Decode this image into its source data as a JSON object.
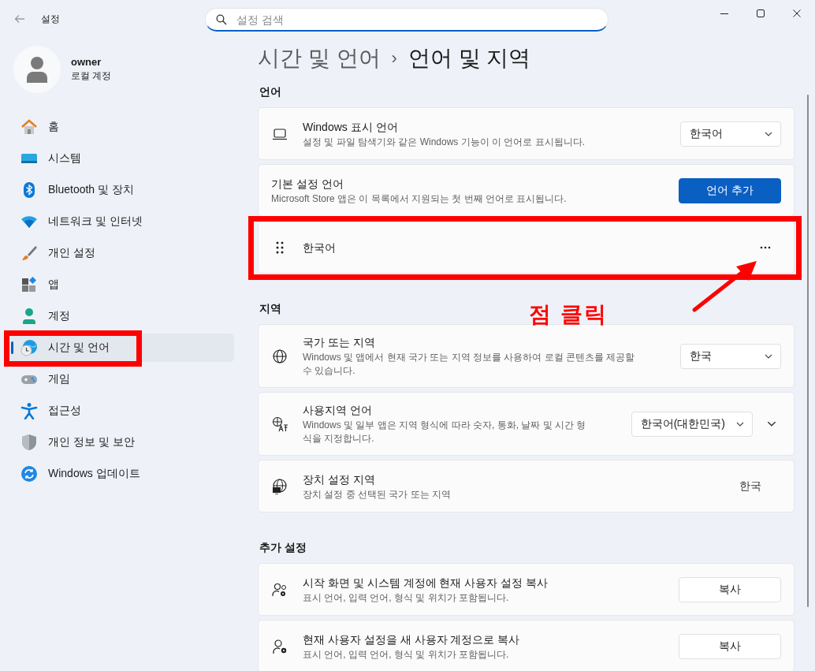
{
  "window": {
    "title": "설정"
  },
  "search": {
    "placeholder": "설정 검색"
  },
  "profile": {
    "name": "owner",
    "account": "로컬 계정"
  },
  "sidebar": {
    "items": [
      {
        "label": "홈",
        "selected": false,
        "highlighted": false
      },
      {
        "label": "시스템",
        "selected": false,
        "highlighted": false
      },
      {
        "label": "Bluetooth 및 장치",
        "selected": false,
        "highlighted": false
      },
      {
        "label": "네트워크 및 인터넷",
        "selected": false,
        "highlighted": false
      },
      {
        "label": "개인 설정",
        "selected": false,
        "highlighted": false
      },
      {
        "label": "앱",
        "selected": false,
        "highlighted": false
      },
      {
        "label": "계정",
        "selected": false,
        "highlighted": false
      },
      {
        "label": "시간 및 언어",
        "selected": true,
        "highlighted": true
      },
      {
        "label": "게임",
        "selected": false,
        "highlighted": false
      },
      {
        "label": "접근성",
        "selected": false,
        "highlighted": false
      },
      {
        "label": "개인 정보 및 보안",
        "selected": false,
        "highlighted": false
      },
      {
        "label": "Windows 업데이트",
        "selected": false,
        "highlighted": false
      }
    ]
  },
  "breadcrumb": {
    "parent": "시간 및 언어",
    "separator": "›",
    "current": "언어 및 지역"
  },
  "sections": [
    {
      "title": "언어",
      "rows": [
        {
          "kind": "dropdown",
          "title": "Windows 표시 언어",
          "description": "설정 및 파일 탐색기와 같은 Windows 기능이 이 언어로 표시됩니다.",
          "value": "한국어",
          "highlighted": false
        },
        {
          "kind": "button",
          "title": "기본 설정 언어",
          "description": "Microsoft Store 앱은 이 목록에서 지원되는 첫 번째 언어로 표시됩니다.",
          "button": "언어 추가",
          "primary": true,
          "highlighted": false
        },
        {
          "kind": "language",
          "title": "한국어",
          "highlighted": true
        }
      ]
    },
    {
      "title": "지역",
      "rows": [
        {
          "kind": "dropdown",
          "title": "국가 또는 지역",
          "description": "Windows 및 앱에서 현재 국가 또는 지역 정보를 사용하여 로컬 콘텐츠를 제공할 수 있습니다.",
          "value": "한국",
          "highlighted": false
        },
        {
          "kind": "dropdown",
          "title": "사용지역 언어",
          "description": "Windows 및 일부 앱은 지역 형식에 따라 숫자, 통화, 날짜 및 시간 형식을 지정합니다.",
          "value": "한국어(대한민국)",
          "expanded": false,
          "highlighted": false
        },
        {
          "kind": "text",
          "title": "장치 설정 지역",
          "description": "장치 설정 중 선택된 국가 또는 지역",
          "value": "한국",
          "highlighted": false
        }
      ]
    },
    {
      "title": "추가 설정",
      "rows": [
        {
          "kind": "button",
          "title": "시작 화면 및 시스템 계정에 현재 사용자 설정 복사",
          "description": "표시 언어, 입력 언어, 형식 및 위치가 포함됩니다.",
          "button": "복사",
          "primary": false,
          "highlighted": false
        },
        {
          "kind": "button",
          "title": "현재 사용자 설정을 새 사용자 계정으로 복사",
          "description": "표시 언어, 입력 언어, 형식 및 위치가 포함됩니다.",
          "button": "복사",
          "primary": false,
          "highlighted": false
        }
      ]
    }
  ],
  "annotation": {
    "caption": "점 클릭"
  }
}
